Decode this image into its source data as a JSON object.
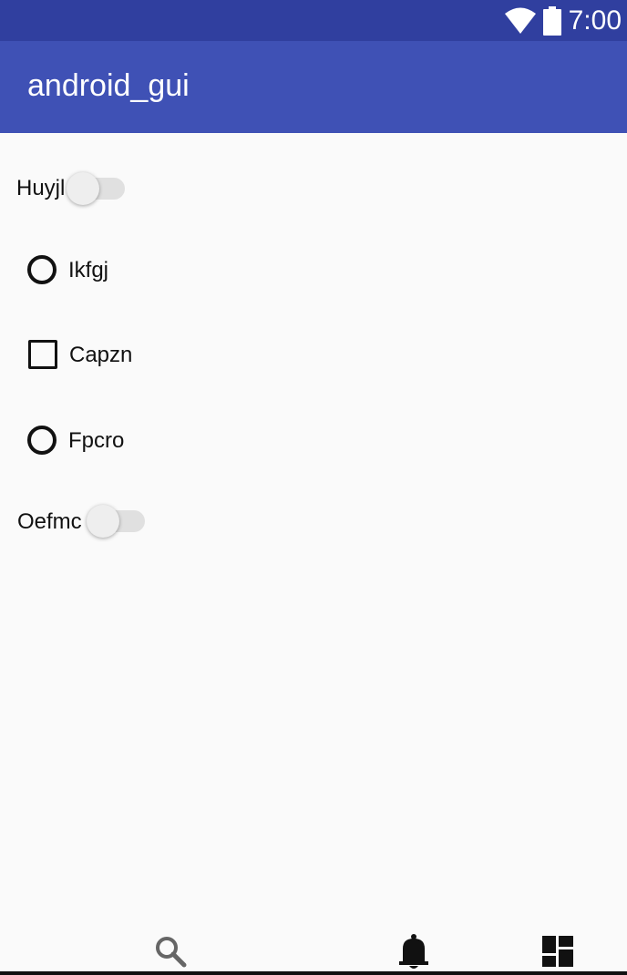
{
  "status_bar": {
    "time": "7:00",
    "icons": [
      "wifi-icon",
      "battery-icon"
    ]
  },
  "app_bar": {
    "title": "android_gui"
  },
  "main": {
    "switch_1": {
      "label": "Huyjl",
      "checked": false
    },
    "radio_1": {
      "label": "Ikfgj",
      "checked": false
    },
    "checkbox_1": {
      "label": "Capzn",
      "checked": false
    },
    "radio_2": {
      "label": "Fpcro",
      "checked": false
    },
    "switch_2": {
      "label": "Oefmc",
      "checked": false
    }
  },
  "bottom_nav": {
    "icons": [
      "search-icon",
      "bell-icon",
      "dashboard-icon"
    ]
  },
  "colors": {
    "status_bar": "#303f9f",
    "app_bar": "#3f51b5",
    "background": "#fafafa",
    "control": "#111111"
  }
}
